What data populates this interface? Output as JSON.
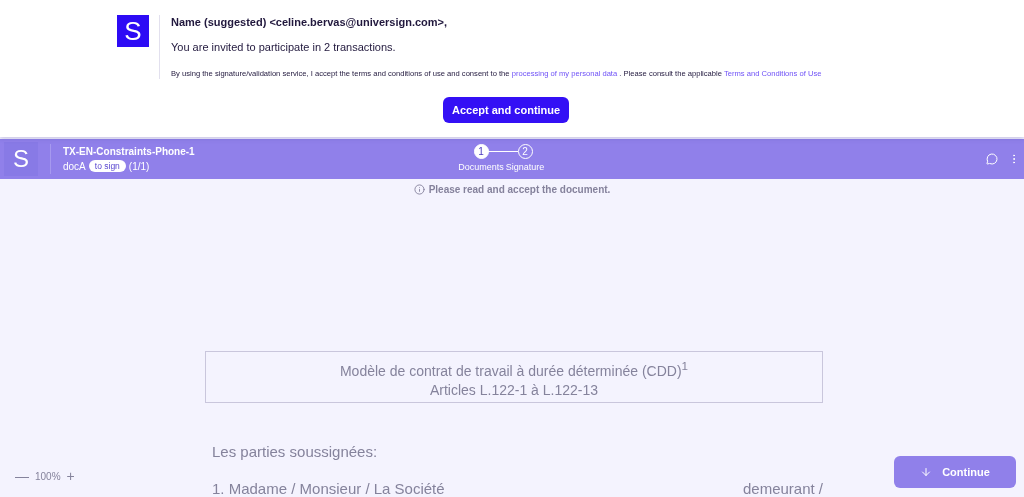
{
  "consent": {
    "greeting": "Name (suggested) <celine.bervas@universign.com>,",
    "invitation": "You are invited to participate in 2 transactions.",
    "terms_before": "By using the signature/validation service, I accept the terms and conditions of use and consent to the",
    "privacy_link": "processing of my personal data",
    "terms_middle": ". Please consult the applicable",
    "terms_link": "Terms and Conditions of Use",
    "button": "Accept and continue",
    "logo": "S"
  },
  "header": {
    "logo": "S",
    "title": "TX-EN-Constraints-Phone-1",
    "document": "docA",
    "badge": "to sign",
    "count": "(1/1)",
    "steps": [
      {
        "number": "1",
        "label": "Documents",
        "selected": true
      },
      {
        "number": "2",
        "label": "Signature",
        "selected": false
      }
    ]
  },
  "notice": "Please read and accept the document.",
  "document": {
    "title": "Modèle de contrat de travail à durée déterminée (CDD)$^{1}$",
    "subtitle": "Articles L.122-1 à L.122-13",
    "parties": "Les parties soussignées:",
    "line_start": "1. Madame / Monsieur / La Société",
    "line_end": "demeurant /"
  },
  "zoom": {
    "minus": "—",
    "value": "100%",
    "plus": "+"
  },
  "continue_button": "Continue"
}
